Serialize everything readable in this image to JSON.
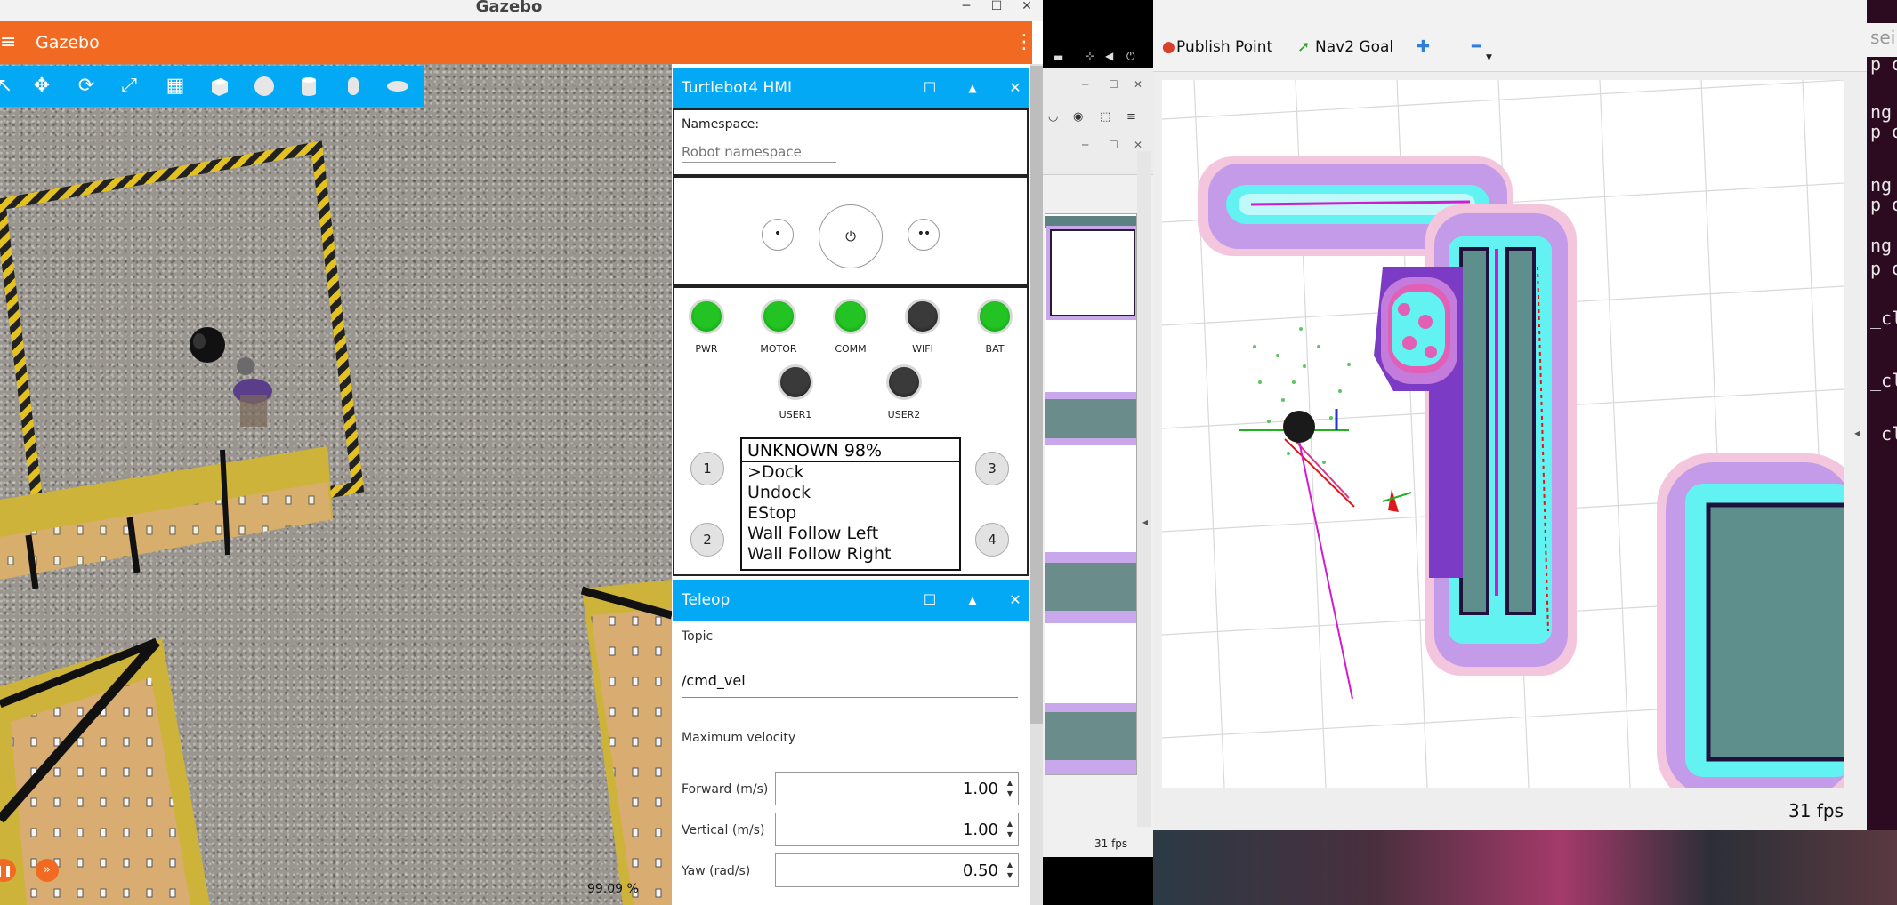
{
  "gazebo": {
    "window_title": "Gazebo",
    "app_title": "Gazebo",
    "menu_icon": "menu-icon",
    "kebab_icon": "more-vert-icon",
    "window_buttons": [
      "─",
      "☐",
      "✕"
    ],
    "toolbar_icons": [
      "select-icon",
      "translate-icon",
      "rotate-icon",
      "snap-icon",
      "grid-icon",
      "box-icon",
      "sphere-icon",
      "cylinder-icon",
      "capsule-icon",
      "ellipsoid-icon"
    ],
    "rtf": "99.09 %",
    "colors": {
      "appbar": "#f26a22",
      "toolbar": "#03a9f4"
    }
  },
  "hmi": {
    "title": "Turtlebot4 HMI",
    "namespace_label": "Namespace:",
    "namespace_placeholder": "Robot namespace",
    "buttons": {
      "left": "•",
      "power": "⏻",
      "right": "••"
    },
    "leds": [
      {
        "label": "PWR",
        "state": "on"
      },
      {
        "label": "MOTOR",
        "state": "on"
      },
      {
        "label": "COMM",
        "state": "on"
      },
      {
        "label": "WIFI",
        "state": "off"
      },
      {
        "label": "BAT",
        "state": "on"
      }
    ],
    "user_leds": [
      {
        "label": "USER1",
        "state": "off"
      },
      {
        "label": "USER2",
        "state": "off"
      }
    ],
    "number_buttons": [
      "1",
      "2",
      "3",
      "4"
    ],
    "display_status": "UNKNOWN 98%",
    "display_items": [
      ">Dock",
      "Undock",
      "EStop",
      "Wall Follow Left",
      "Wall Follow Right"
    ]
  },
  "teleop": {
    "title": "Teleop",
    "topic_label": "Topic",
    "topic_value": "/cmd_vel",
    "max_velocity_label": "Maximum velocity",
    "fields": [
      {
        "label": "Forward (m/s)",
        "value": "1.00"
      },
      {
        "label": "Vertical (m/s)",
        "value": "1.00"
      },
      {
        "label": "Yaw (rad/s)",
        "value": "0.50"
      }
    ]
  },
  "panel_buttons": {
    "maximize": "☐",
    "collapse": "▲",
    "close": "✕"
  },
  "browser": {
    "fps": "31 fps"
  },
  "rviz": {
    "tools": [
      {
        "label": "Publish Point",
        "icon": "map-pin-icon"
      },
      {
        "label": "Nav2 Goal",
        "icon": "goal-arrow-icon"
      },
      {
        "label": "",
        "icon": "plus-icon"
      },
      {
        "label": "",
        "icon": "minus-icon"
      }
    ],
    "fps": "31 fps",
    "colors": {
      "inflation": "#b78de6",
      "obstacle_near": "#52f0f0",
      "lethal": "#d400c8"
    }
  },
  "terminal": {
    "lines": [
      "seil",
      "p on",
      "ng m",
      "p on",
      "ng m",
      "p on",
      "ng m",
      "p on",
      "_cli",
      "_cli",
      "_cli"
    ]
  }
}
